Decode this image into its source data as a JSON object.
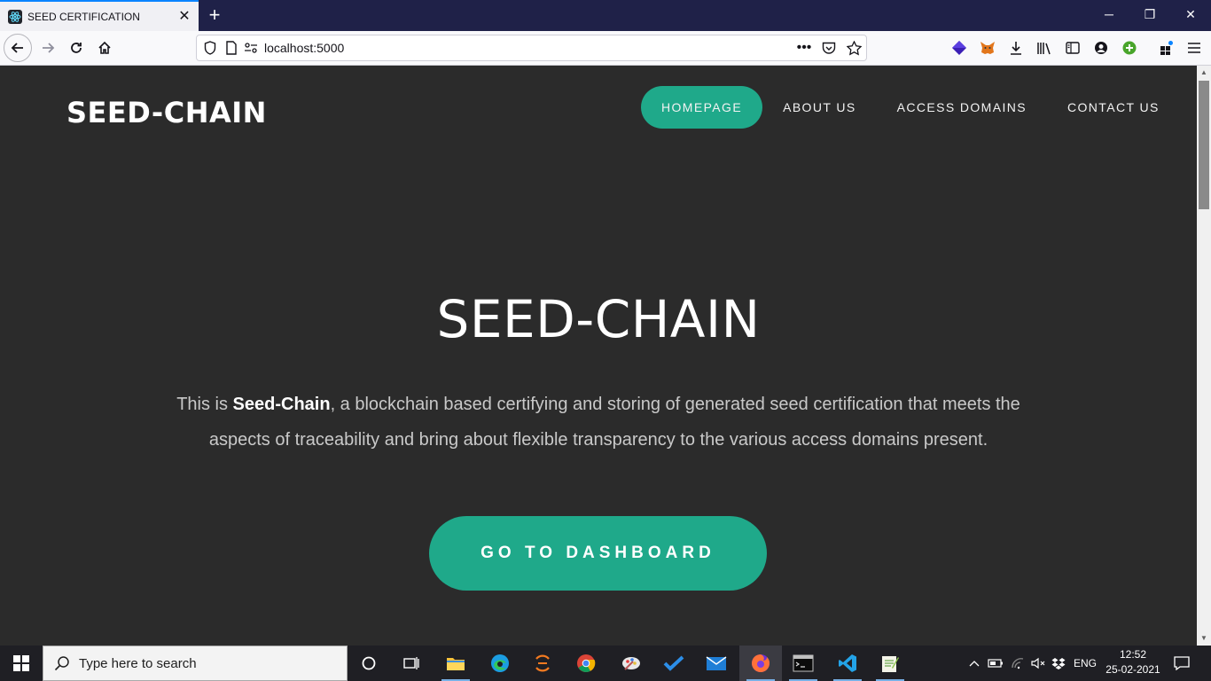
{
  "browser": {
    "tab_title": "SEED CERTIFICATION",
    "url": "localhost:5000"
  },
  "site": {
    "brand": "SEED-CHAIN",
    "nav": [
      {
        "label": "HOMEPAGE",
        "active": true
      },
      {
        "label": "ABOUT US",
        "active": false
      },
      {
        "label": "ACCESS DOMAINS",
        "active": false
      },
      {
        "label": "CONTACT US",
        "active": false
      }
    ],
    "hero": {
      "title": "SEED-CHAIN",
      "text_prefix": "This is ",
      "text_bold": "Seed-Chain",
      "text_suffix": ", a blockchain based certifying and storing of generated seed certification that meets the aspects of traceability and bring about flexible transparency to the various access domains present.",
      "cta_label": "GO TO DASHBOARD"
    },
    "colors": {
      "accent": "#1fa98a",
      "background": "#2b2b2b"
    }
  },
  "taskbar": {
    "search_placeholder": "Type here to search",
    "language": "ENG",
    "time": "12:52",
    "date": "25-02-2021",
    "apps": [
      "cortana-icon",
      "task-view-icon",
      "file-explorer-icon",
      "edge-icon",
      "eclipse-icon",
      "chrome-icon",
      "paint-icon",
      "todo-icon",
      "mail-icon",
      "firefox-icon",
      "terminal-icon",
      "vscode-icon",
      "notepad-plus-icon"
    ]
  }
}
